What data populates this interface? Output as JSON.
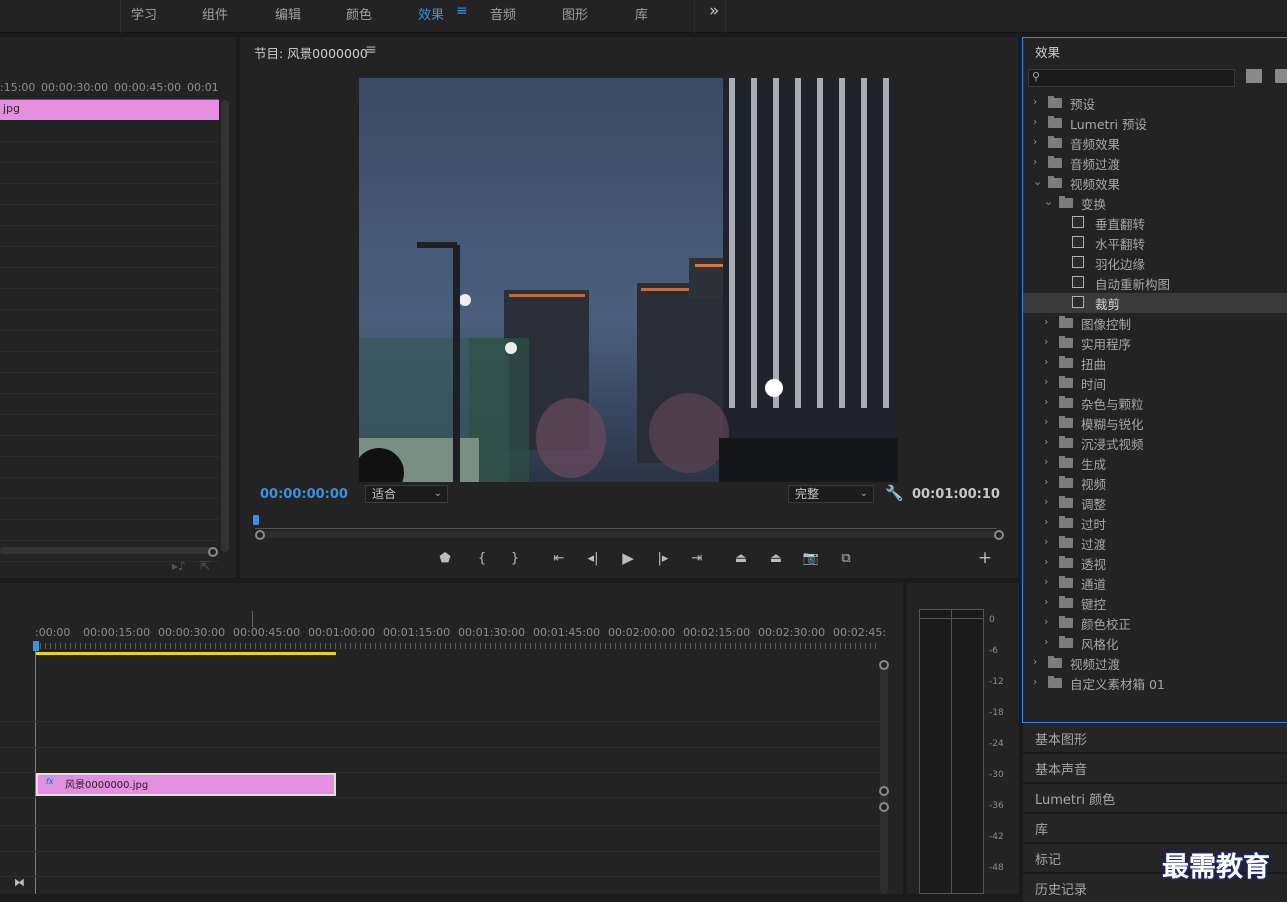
{
  "workspaces": {
    "tabs": [
      {
        "label": "学习"
      },
      {
        "label": "组件"
      },
      {
        "label": "编辑"
      },
      {
        "label": "颜色"
      },
      {
        "label": "效果",
        "active": true
      },
      {
        "label": "音频"
      },
      {
        "label": "图形"
      },
      {
        "label": "库"
      }
    ],
    "more": "»"
  },
  "source": {
    "ruler": [
      ":15:00",
      "00:00:30:00",
      "00:00:45:00",
      "00:01"
    ],
    "clip": "jpg"
  },
  "program": {
    "title": "节目: 风景0000000",
    "timecode_left": "00:00:00:00",
    "fit": "适合",
    "quality": "完整",
    "timecode_right": "00:01:00:10"
  },
  "timeline": {
    "ruler": [
      ":00:00",
      "00:00:15:00",
      "00:00:30:00",
      "00:00:45:00",
      "00:01:00:00",
      "00:01:15:00",
      "00:01:30:00",
      "00:01:45:00",
      "00:02:00:00",
      "00:02:15:00",
      "00:02:30:00",
      "00:02:45:"
    ],
    "clip_label": "风景0000000.jpg",
    "fx_badge": "fx"
  },
  "meter": {
    "scale": [
      "0",
      "-6",
      "-12",
      "-18",
      "-24",
      "-30",
      "-36",
      "-42",
      "-48"
    ]
  },
  "effects": {
    "title": "效果",
    "items": [
      {
        "label": "预设",
        "level": 0,
        "icon": "folder-star",
        "open": false
      },
      {
        "label": "Lumetri 预设",
        "level": 0,
        "icon": "folder-star",
        "open": false
      },
      {
        "label": "音频效果",
        "level": 0,
        "icon": "folder",
        "open": false
      },
      {
        "label": "音频过渡",
        "level": 0,
        "icon": "folder",
        "open": false
      },
      {
        "label": "视频效果",
        "level": 0,
        "icon": "folder",
        "open": true
      },
      {
        "label": "变换",
        "level": 1,
        "icon": "folder",
        "open": true
      },
      {
        "label": "垂直翻转",
        "level": 2,
        "icon": "effect"
      },
      {
        "label": "水平翻转",
        "level": 2,
        "icon": "effect"
      },
      {
        "label": "羽化边缘",
        "level": 2,
        "icon": "effect"
      },
      {
        "label": "自动重新构图",
        "level": 2,
        "icon": "effect"
      },
      {
        "label": "裁剪",
        "level": 2,
        "icon": "effect",
        "selected": true
      },
      {
        "label": "图像控制",
        "level": 1,
        "icon": "folder",
        "open": false
      },
      {
        "label": "实用程序",
        "level": 1,
        "icon": "folder",
        "open": false
      },
      {
        "label": "扭曲",
        "level": 1,
        "icon": "folder",
        "open": false
      },
      {
        "label": "时间",
        "level": 1,
        "icon": "folder",
        "open": false
      },
      {
        "label": "杂色与颗粒",
        "level": 1,
        "icon": "folder",
        "open": false
      },
      {
        "label": "模糊与锐化",
        "level": 1,
        "icon": "folder",
        "open": false
      },
      {
        "label": "沉浸式视频",
        "level": 1,
        "icon": "folder",
        "open": false
      },
      {
        "label": "生成",
        "level": 1,
        "icon": "folder",
        "open": false
      },
      {
        "label": "视频",
        "level": 1,
        "icon": "folder",
        "open": false
      },
      {
        "label": "调整",
        "level": 1,
        "icon": "folder",
        "open": false
      },
      {
        "label": "过时",
        "level": 1,
        "icon": "folder",
        "open": false
      },
      {
        "label": "过渡",
        "level": 1,
        "icon": "folder",
        "open": false
      },
      {
        "label": "透视",
        "level": 1,
        "icon": "folder",
        "open": false
      },
      {
        "label": "通道",
        "level": 1,
        "icon": "folder",
        "open": false
      },
      {
        "label": "键控",
        "level": 1,
        "icon": "folder",
        "open": false
      },
      {
        "label": "颜色校正",
        "level": 1,
        "icon": "folder",
        "open": false
      },
      {
        "label": "风格化",
        "level": 1,
        "icon": "folder",
        "open": false
      },
      {
        "label": "视频过渡",
        "level": 0,
        "icon": "folder",
        "open": false
      },
      {
        "label": "自定义素材箱 01",
        "level": 0,
        "icon": "folder",
        "open": false
      }
    ]
  },
  "collapsed_panels": [
    {
      "label": "基本图形"
    },
    {
      "label": "基本声音"
    },
    {
      "label": "Lumetri 颜色"
    },
    {
      "label": "库"
    },
    {
      "label": "标记"
    },
    {
      "label": "历史记录"
    }
  ],
  "watermark": "最需教育",
  "colors": {
    "accent": "#3d8fe0",
    "clip": "#e58ee0",
    "work_area": "#e8d41c",
    "panel_border": "#2d8ceb"
  }
}
